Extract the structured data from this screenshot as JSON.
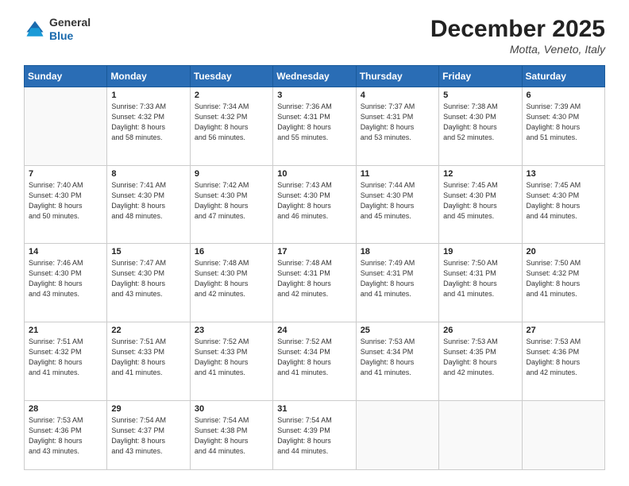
{
  "header": {
    "logo_general": "General",
    "logo_blue": "Blue",
    "month": "December 2025",
    "location": "Motta, Veneto, Italy"
  },
  "days_of_week": [
    "Sunday",
    "Monday",
    "Tuesday",
    "Wednesday",
    "Thursday",
    "Friday",
    "Saturday"
  ],
  "weeks": [
    [
      {
        "day": "",
        "info": ""
      },
      {
        "day": "1",
        "info": "Sunrise: 7:33 AM\nSunset: 4:32 PM\nDaylight: 8 hours\nand 58 minutes."
      },
      {
        "day": "2",
        "info": "Sunrise: 7:34 AM\nSunset: 4:32 PM\nDaylight: 8 hours\nand 56 minutes."
      },
      {
        "day": "3",
        "info": "Sunrise: 7:36 AM\nSunset: 4:31 PM\nDaylight: 8 hours\nand 55 minutes."
      },
      {
        "day": "4",
        "info": "Sunrise: 7:37 AM\nSunset: 4:31 PM\nDaylight: 8 hours\nand 53 minutes."
      },
      {
        "day": "5",
        "info": "Sunrise: 7:38 AM\nSunset: 4:30 PM\nDaylight: 8 hours\nand 52 minutes."
      },
      {
        "day": "6",
        "info": "Sunrise: 7:39 AM\nSunset: 4:30 PM\nDaylight: 8 hours\nand 51 minutes."
      }
    ],
    [
      {
        "day": "7",
        "info": "Sunrise: 7:40 AM\nSunset: 4:30 PM\nDaylight: 8 hours\nand 50 minutes."
      },
      {
        "day": "8",
        "info": "Sunrise: 7:41 AM\nSunset: 4:30 PM\nDaylight: 8 hours\nand 48 minutes."
      },
      {
        "day": "9",
        "info": "Sunrise: 7:42 AM\nSunset: 4:30 PM\nDaylight: 8 hours\nand 47 minutes."
      },
      {
        "day": "10",
        "info": "Sunrise: 7:43 AM\nSunset: 4:30 PM\nDaylight: 8 hours\nand 46 minutes."
      },
      {
        "day": "11",
        "info": "Sunrise: 7:44 AM\nSunset: 4:30 PM\nDaylight: 8 hours\nand 45 minutes."
      },
      {
        "day": "12",
        "info": "Sunrise: 7:45 AM\nSunset: 4:30 PM\nDaylight: 8 hours\nand 45 minutes."
      },
      {
        "day": "13",
        "info": "Sunrise: 7:45 AM\nSunset: 4:30 PM\nDaylight: 8 hours\nand 44 minutes."
      }
    ],
    [
      {
        "day": "14",
        "info": "Sunrise: 7:46 AM\nSunset: 4:30 PM\nDaylight: 8 hours\nand 43 minutes."
      },
      {
        "day": "15",
        "info": "Sunrise: 7:47 AM\nSunset: 4:30 PM\nDaylight: 8 hours\nand 43 minutes."
      },
      {
        "day": "16",
        "info": "Sunrise: 7:48 AM\nSunset: 4:30 PM\nDaylight: 8 hours\nand 42 minutes."
      },
      {
        "day": "17",
        "info": "Sunrise: 7:48 AM\nSunset: 4:31 PM\nDaylight: 8 hours\nand 42 minutes."
      },
      {
        "day": "18",
        "info": "Sunrise: 7:49 AM\nSunset: 4:31 PM\nDaylight: 8 hours\nand 41 minutes."
      },
      {
        "day": "19",
        "info": "Sunrise: 7:50 AM\nSunset: 4:31 PM\nDaylight: 8 hours\nand 41 minutes."
      },
      {
        "day": "20",
        "info": "Sunrise: 7:50 AM\nSunset: 4:32 PM\nDaylight: 8 hours\nand 41 minutes."
      }
    ],
    [
      {
        "day": "21",
        "info": "Sunrise: 7:51 AM\nSunset: 4:32 PM\nDaylight: 8 hours\nand 41 minutes."
      },
      {
        "day": "22",
        "info": "Sunrise: 7:51 AM\nSunset: 4:33 PM\nDaylight: 8 hours\nand 41 minutes."
      },
      {
        "day": "23",
        "info": "Sunrise: 7:52 AM\nSunset: 4:33 PM\nDaylight: 8 hours\nand 41 minutes."
      },
      {
        "day": "24",
        "info": "Sunrise: 7:52 AM\nSunset: 4:34 PM\nDaylight: 8 hours\nand 41 minutes."
      },
      {
        "day": "25",
        "info": "Sunrise: 7:53 AM\nSunset: 4:34 PM\nDaylight: 8 hours\nand 41 minutes."
      },
      {
        "day": "26",
        "info": "Sunrise: 7:53 AM\nSunset: 4:35 PM\nDaylight: 8 hours\nand 42 minutes."
      },
      {
        "day": "27",
        "info": "Sunrise: 7:53 AM\nSunset: 4:36 PM\nDaylight: 8 hours\nand 42 minutes."
      }
    ],
    [
      {
        "day": "28",
        "info": "Sunrise: 7:53 AM\nSunset: 4:36 PM\nDaylight: 8 hours\nand 43 minutes."
      },
      {
        "day": "29",
        "info": "Sunrise: 7:54 AM\nSunset: 4:37 PM\nDaylight: 8 hours\nand 43 minutes."
      },
      {
        "day": "30",
        "info": "Sunrise: 7:54 AM\nSunset: 4:38 PM\nDaylight: 8 hours\nand 44 minutes."
      },
      {
        "day": "31",
        "info": "Sunrise: 7:54 AM\nSunset: 4:39 PM\nDaylight: 8 hours\nand 44 minutes."
      },
      {
        "day": "",
        "info": ""
      },
      {
        "day": "",
        "info": ""
      },
      {
        "day": "",
        "info": ""
      }
    ]
  ]
}
